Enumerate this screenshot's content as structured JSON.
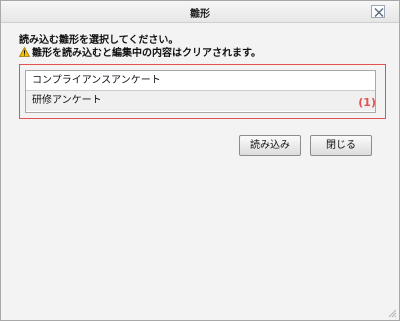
{
  "dialog": {
    "title": "雛形"
  },
  "instructions": {
    "line1": "読み込む雛形を選択してください。",
    "warning": "雛形を読み込むと編集中の内容はクリアされます。"
  },
  "templates": {
    "items": [
      {
        "label": "コンプライアンスアンケート"
      },
      {
        "label": "研修アンケート"
      }
    ],
    "annotation": "(1)"
  },
  "buttons": {
    "load_label": "読み込み",
    "close_label": "閉じる"
  },
  "colors": {
    "annotation": "#e25252",
    "warning": "#f2c200"
  },
  "icons": {
    "close": "close-icon",
    "warning": "warning-icon",
    "resize": "resize-grip-icon"
  }
}
